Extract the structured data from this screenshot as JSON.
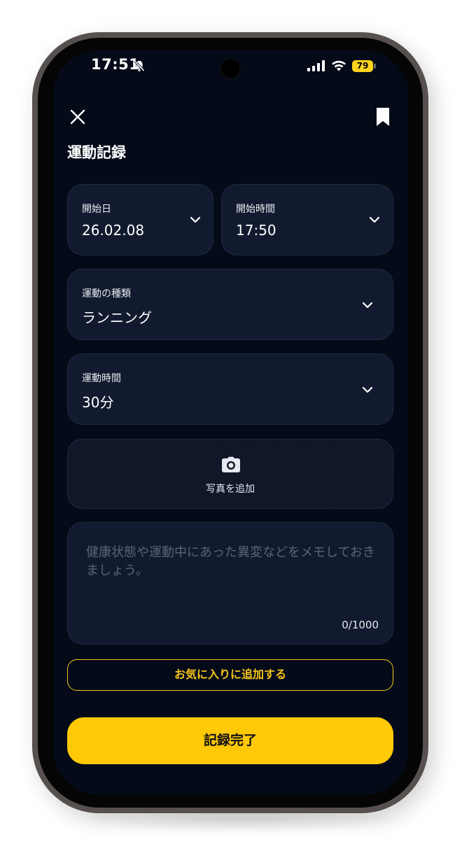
{
  "status_bar": {
    "time": "17:51",
    "battery": "79"
  },
  "header": {
    "title": "運動記録"
  },
  "form": {
    "start_date": {
      "label": "開始日",
      "value": "26.02.08"
    },
    "start_time": {
      "label": "開始時間",
      "value": "17:50"
    },
    "exercise_type": {
      "label": "運動の種類",
      "value": "ランニング"
    },
    "duration": {
      "label": "運動時間",
      "value": "30分"
    },
    "photo": {
      "label": "写真を追加"
    },
    "memo": {
      "placeholder": "健康状態や運動中にあった異変などをメモしておきましょう。",
      "counter": "0/1000"
    }
  },
  "actions": {
    "favorite_label": "お気に入りに追加する",
    "complete_label": "記録完了"
  },
  "colors": {
    "background": "#040a18",
    "card": "#111a2e",
    "accent": "#ffc907",
    "accent_outline": "#f5c518",
    "placeholder": "#5b6478"
  },
  "icons": {
    "close": "close-icon",
    "bookmark": "bookmark-icon",
    "chevron": "chevron-down-icon",
    "camera": "camera-icon",
    "bell_off": "bell-off-icon",
    "signal": "signal-icon",
    "wifi": "wifi-icon",
    "battery": "battery-icon"
  }
}
